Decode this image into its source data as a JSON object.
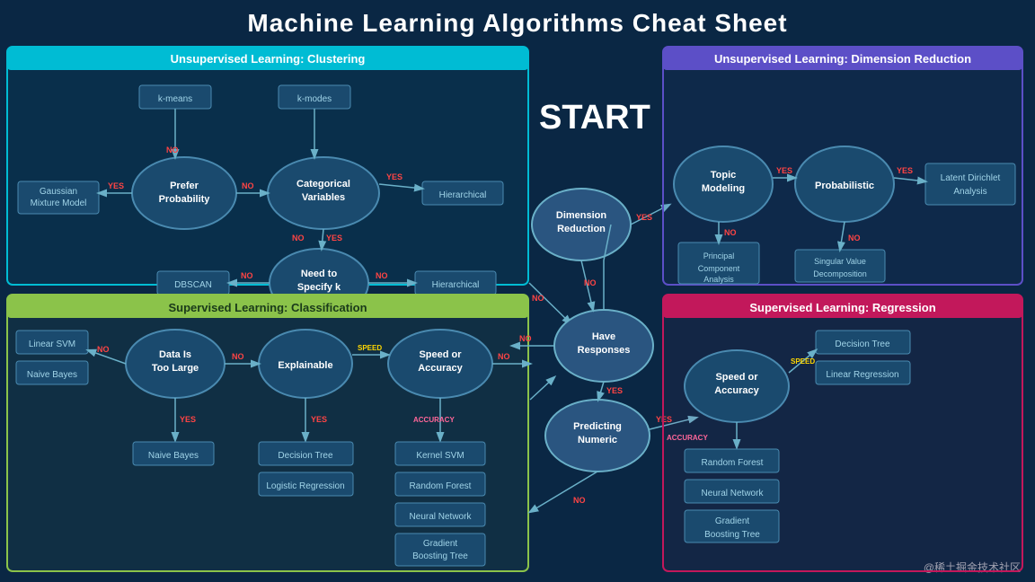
{
  "title": "Machine Learning Algorithms Cheat Sheet",
  "watermark": "@稀土掘金技术社区",
  "sections": {
    "clustering": {
      "header": "Unsupervised Learning: Clustering",
      "nodes": {
        "preferProbability": "Prefer\nProbability",
        "categoricalVariables": "Categorical\nVariables",
        "hierarchical1": "Hierarchical",
        "needToSpecifyK": "Need to\nSpecify k",
        "hierarchical2": "Hierarchical",
        "gaussianMixtureModel": "Gaussian\nMixture Model",
        "kMeans": "k-means",
        "kModes": "k-modes",
        "dbscan": "DBSCAN"
      }
    },
    "classification": {
      "header": "Supervised Learning: Classification",
      "nodes": {
        "dataIsTooLarge": "Data Is\nToo Large",
        "explainable": "Explainable",
        "speedOrAccuracy": "Speed or\nAccuracy",
        "linearSVM": "Linear SVM",
        "naiveBayes1": "Naive Bayes",
        "naiveBayes2": "Naive Bayes",
        "decisionTree1": "Decision Tree",
        "logisticRegression": "Logistic Regression",
        "kernelSVM": "Kernel SVM",
        "randomForest1": "Random Forest",
        "neuralNetwork1": "Neural Network",
        "gradientBoostingTree1": "Gradient\nBoosting Tree"
      }
    },
    "center": {
      "start": "START",
      "dimensionReduction": "Dimension\nReduction",
      "haveResponses": "Have\nResponses",
      "predictingNumeric": "Predicting\nNumeric"
    },
    "dimReduction": {
      "header": "Unsupervised Learning: Dimension Reduction",
      "nodes": {
        "topicModeling": "Topic\nModeling",
        "probabilistic": "Probabilistic",
        "latentDirichletAnalysis": "Latent Dirichlet\nAnalysis",
        "principalComponentAnalysis": "Principal\nComponent\nAnalysis",
        "singularValueDecomposition": "Singular Value\nDecomposition"
      }
    },
    "regression": {
      "header": "Supervised Learning: Regression",
      "nodes": {
        "speedOrAccuracy": "Speed or\nAccuracy",
        "decisionTree": "Decision Tree",
        "linearRegression": "Linear Regression",
        "randomForest": "Random Forest",
        "neuralNetwork": "Neural Network",
        "gradientBoostingTree": "Gradient\nBoosting Tree"
      }
    }
  },
  "labels": {
    "yes": "YES",
    "no": "NO",
    "speed": "SPEED",
    "accuracy": "ACCURACY"
  }
}
